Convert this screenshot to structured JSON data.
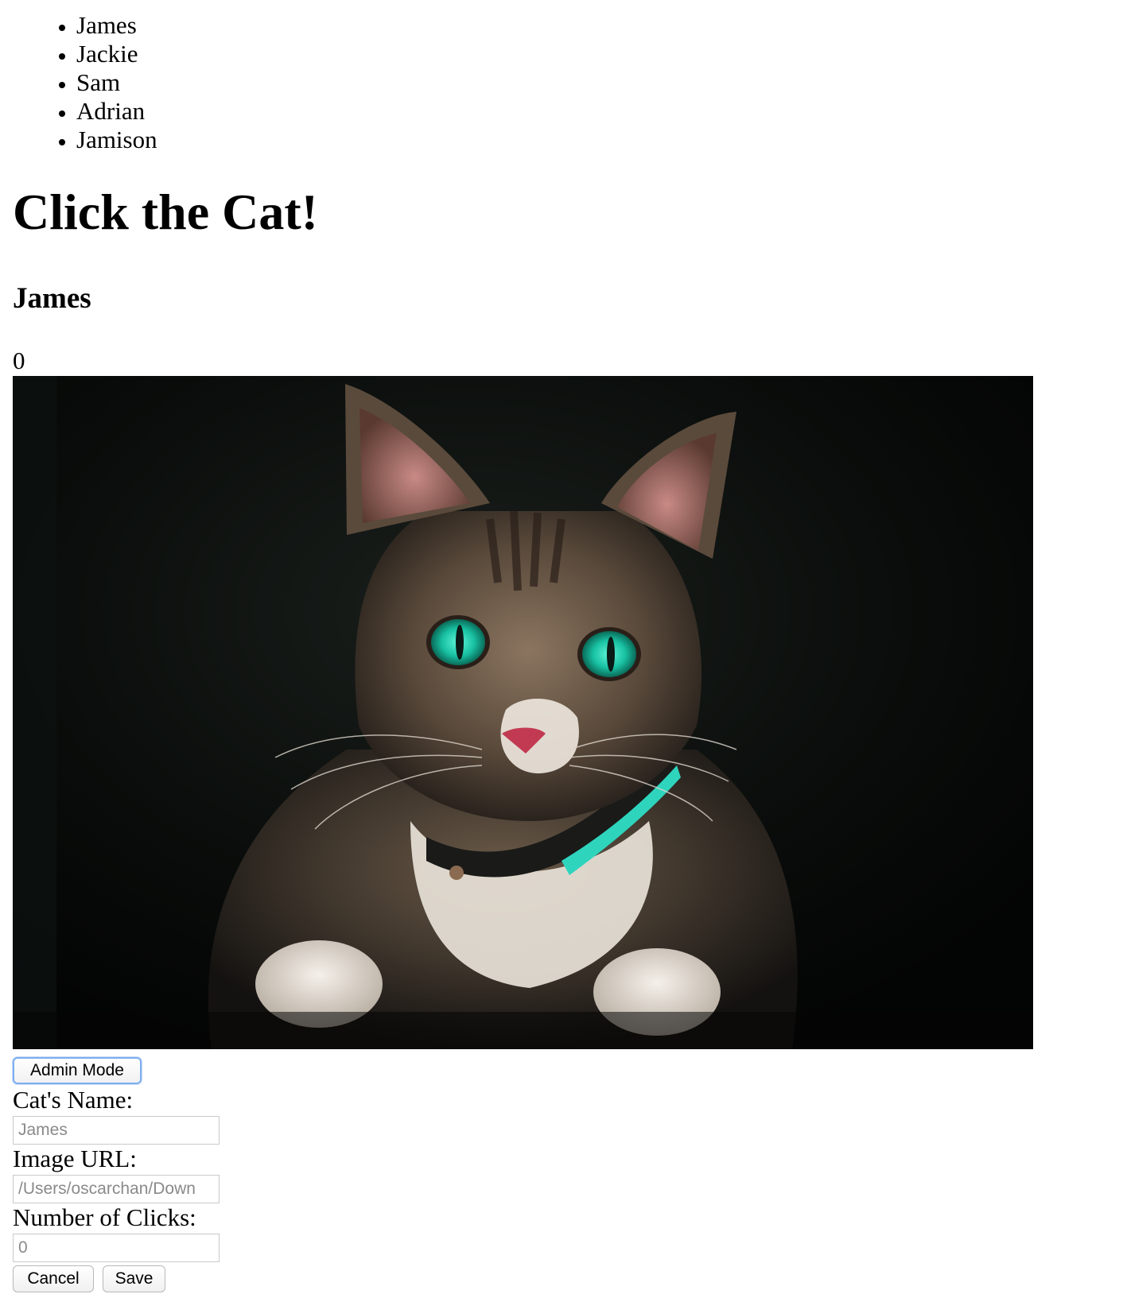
{
  "cat_list": {
    "items": [
      "James",
      "Jackie",
      "Sam",
      "Adrian",
      "Jamison"
    ]
  },
  "header": {
    "title": "Click the Cat!"
  },
  "current_cat": {
    "name": "James",
    "clicks": "0",
    "image_alt": "tabby cat with green eyes"
  },
  "admin": {
    "button_label": "Admin Mode",
    "name_label": "Cat's Name:",
    "name_placeholder": "James",
    "url_label": "Image URL:",
    "url_placeholder": "/Users/oscarchan/Down",
    "clicks_label": "Number of Clicks:",
    "clicks_placeholder": "0",
    "cancel_label": "Cancel",
    "save_label": "Save"
  }
}
